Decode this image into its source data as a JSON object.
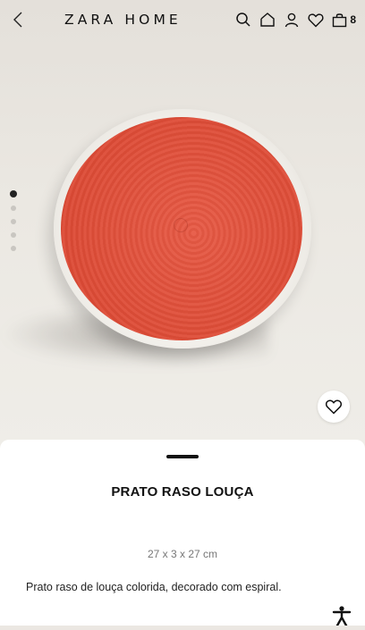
{
  "header": {
    "brand": "ZARA HOME",
    "cart_count": "8",
    "icons": [
      "back-arrow-icon",
      "search-icon",
      "home-icon",
      "user-icon",
      "heart-icon",
      "bag-icon"
    ]
  },
  "gallery": {
    "image_count": 5,
    "active_index": 0
  },
  "product": {
    "name": "PRATO RASO LOUÇA",
    "dimensions": "27 x 3 x 27 cm",
    "description": "Prato raso de louça colorida, decorado com espiral."
  },
  "colors": {
    "plate": "#df4e39",
    "background": "#ebe7e2"
  }
}
